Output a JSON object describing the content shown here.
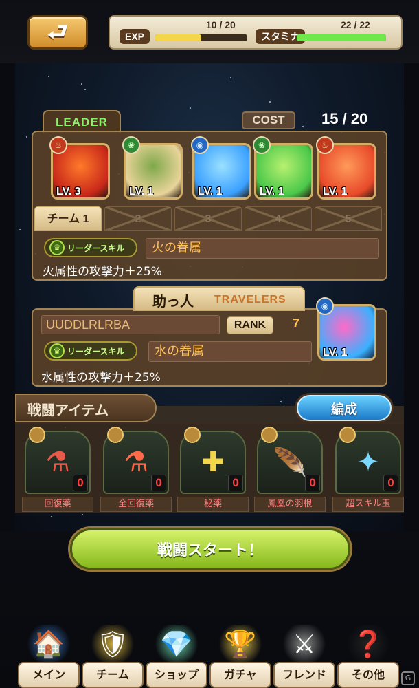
{
  "header": {
    "back_icon": "return-arrow-icon",
    "exp_label": "EXP",
    "exp_value": "10 / 20",
    "exp_progress": 0.5,
    "stamina_label": "スタミナ",
    "stamina_value": "22 / 22",
    "stamina_progress": 1.0,
    "colors": {
      "exp_bar": "#f4d64a",
      "stamina_bar": "#6ee84a"
    }
  },
  "team": {
    "leader_label": "LEADER",
    "cost_label": "COST",
    "cost_value": "15 / 20",
    "monsters": [
      {
        "element": "fire",
        "level": "LV. 3",
        "colors": [
          "#c8281a",
          "#ff7a2a"
        ]
      },
      {
        "element": "wood",
        "level": "LV. 1",
        "colors": [
          "#e9d49a",
          "#7fa84a"
        ]
      },
      {
        "element": "water",
        "level": "LV. 1",
        "colors": [
          "#3aa0ff",
          "#9ae0ff"
        ]
      },
      {
        "element": "wood",
        "level": "LV. 1",
        "colors": [
          "#4ac84a",
          "#b8f070"
        ]
      },
      {
        "element": "fire",
        "level": "LV. 1",
        "colors": [
          "#e84a2a",
          "#ff9a5a"
        ]
      }
    ],
    "tabs": [
      "チーム 1",
      "2",
      "3",
      "4",
      "5"
    ],
    "active_tab": 0,
    "leader_skill_badge": "リーダースキル",
    "leader_skill_name": "火の眷属",
    "leader_skill_desc": "火属性の攻撃力＋25%"
  },
  "helper": {
    "title": "助っ人",
    "subtitle": "TRAVELERS",
    "name": "UUDDLRLRBA",
    "rank_label": "RANK",
    "rank_value": "7",
    "skill_badge": "リーダースキル",
    "skill_name": "水の眷属",
    "skill_desc": "水属性の攻撃力＋25%",
    "monster": {
      "element": "water",
      "level": "LV. 1",
      "colors": [
        "#ff6ac8",
        "#3ab0ff"
      ]
    }
  },
  "items": {
    "header": "戦闘アイテム",
    "edit_button": "編成",
    "list": [
      {
        "label": "回復薬",
        "count": "0",
        "icon": "potion-icon",
        "glyph": "⚗"
      },
      {
        "label": "全回復薬",
        "count": "0",
        "icon": "full-potion-icon",
        "glyph": "⚗"
      },
      {
        "label": "秘薬",
        "count": "0",
        "icon": "elixir-icon",
        "glyph": "✚"
      },
      {
        "label": "鳳凰の羽根",
        "count": "0",
        "icon": "phoenix-feather-icon",
        "glyph": "🪶"
      },
      {
        "label": "超スキル玉",
        "count": "0",
        "icon": "skill-orb-icon",
        "glyph": "✦"
      }
    ]
  },
  "start_button": "戦闘スタート！",
  "nav": [
    {
      "label": "メイン",
      "icon": "house-icon",
      "glyph": "🏠"
    },
    {
      "label": "チーム",
      "icon": "shield-icon",
      "glyph": "🛡"
    },
    {
      "label": "ショップ",
      "icon": "crystal-icon",
      "glyph": "💎"
    },
    {
      "label": "ガチャ",
      "icon": "gacha-statue-icon",
      "glyph": "🏆"
    },
    {
      "label": "フレンド",
      "icon": "knight-icon",
      "glyph": "⚔"
    },
    {
      "label": "その他",
      "icon": "mystery-box-icon",
      "glyph": "❓"
    }
  ]
}
